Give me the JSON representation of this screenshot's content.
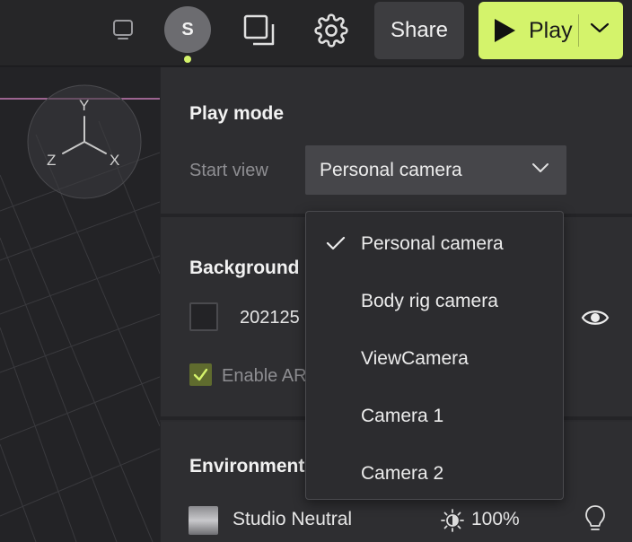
{
  "topbar": {
    "avatar_initial": "S",
    "share_label": "Share",
    "play_label": "Play"
  },
  "viewport": {
    "axes": {
      "y": "Y",
      "z": "Z",
      "x": "X"
    }
  },
  "play_mode": {
    "title": "Play mode",
    "start_view_label": "Start view",
    "start_view_value": "Personal camera"
  },
  "background": {
    "title": "Background",
    "item_name": "202125",
    "enable_label": "Enable AR"
  },
  "environment": {
    "title": "Environment",
    "name": "Studio Neutral",
    "intensity": "100%"
  },
  "dropdown": {
    "options": [
      {
        "label": "Personal camera",
        "selected": true
      },
      {
        "label": "Body rig camera",
        "selected": false
      },
      {
        "label": "ViewCamera",
        "selected": false
      },
      {
        "label": "Camera 1",
        "selected": false
      },
      {
        "label": "Camera 2",
        "selected": false
      }
    ]
  },
  "colors": {
    "accent": "#d4f36b",
    "background": "#1f1f22",
    "panel": "#2e2e31",
    "select": "#46464a"
  },
  "icons": [
    "monitor-icon",
    "duplicate-icon",
    "gear-icon",
    "play-icon",
    "chevron-down-icon",
    "eye-icon",
    "sun-icon",
    "lightbulb-icon",
    "check-icon"
  ]
}
